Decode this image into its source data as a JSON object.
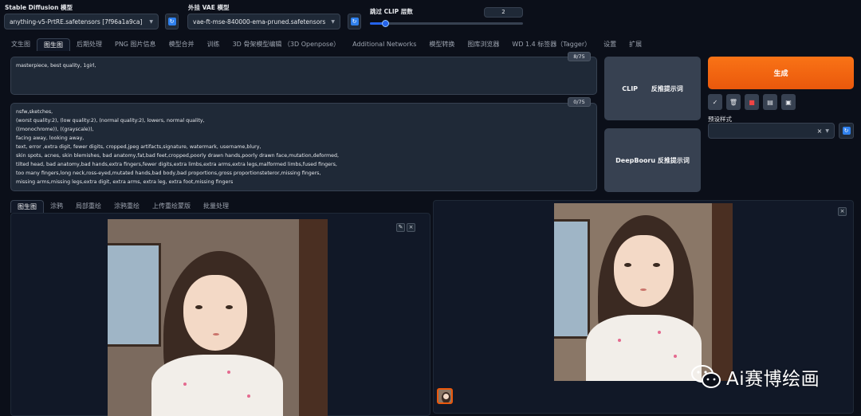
{
  "model": {
    "sd_label": "Stable Diffusion 模型",
    "sd_value": "anything-v5-PrtRE.safetensors [7f96a1a9ca]",
    "vae_label": "外挂 VAE 模型",
    "vae_value": "vae-ft-mse-840000-ema-pruned.safetensors",
    "clip_label": "跳过 CLIP 层数",
    "clip_value": "2",
    "clip_slider_fraction": 0.1
  },
  "main_tabs": [
    "文生图",
    "图生图",
    "后期处理",
    "PNG 图片信息",
    "模型合并",
    "训练",
    "3D 骨架模型编辑 （3D Openpose）",
    "Additional Networks",
    "模型转换",
    "图库浏览器",
    "WD 1.4 标签器（Tagger）",
    "设置",
    "扩展"
  ],
  "active_main_tab": 1,
  "prompt": {
    "positive": "masterpiece, best quality,  1girl,",
    "positive_count": "8/75",
    "negative_lines": [
      "nsfw,sketches,",
      "(worst quality:2), (low quality:2), (normal quality:2), lowers, normal quality,",
      "((monochrome)), ((grayscale)),",
      "facing away, looking away,",
      "text, error ,extra digit, fewer digits, cropped,jpeg artifacts,signature, watermark, username,blury,",
      "skin spots, acnes, skin blemishes, bad anatomy,fat,bad feet,cropped,poorly drawn hands,poorly drawn face,mutation,deformed,",
      "tilted head, bad anatomy,bad hands,extra fingers,fewer digits,extra limbs,extra arms,extra legs,malformed limbs,fused fingers,",
      "too many fingers,long neck,ross-eyed,mutated hands,bad body,bad proportions,gross proportionsteteror,missing fingers,",
      "missing arms,missing legs,extra digit, extra arms, extra leg, extra foot,missing fingers"
    ],
    "negative_count": "0/75"
  },
  "buttons": {
    "clip_interrogate": "CLIP      反推提示词",
    "deepbooru_interrogate": "DeepBooru 反推提示词",
    "generate": "生成",
    "tool_icons": [
      "check-icon",
      "trash-icon",
      "red-flag-icon",
      "clipboard-icon",
      "save-style-icon"
    ],
    "tool_glyphs": [
      "✓",
      "🗑",
      "■",
      "▤",
      "▣"
    ],
    "styles_label": "预设样式",
    "styles_clear": "×"
  },
  "sub_tabs": [
    "图生图",
    "涂鸦",
    "局部重绘",
    "涂鸦重绘",
    "上传重绘蒙版",
    "批量处理"
  ],
  "active_sub_tab": 0,
  "watermark": "Ai赛博绘画",
  "colors": {
    "background": "#0b0f19",
    "accent": "#ea580c",
    "primary_blue": "#2563eb"
  }
}
